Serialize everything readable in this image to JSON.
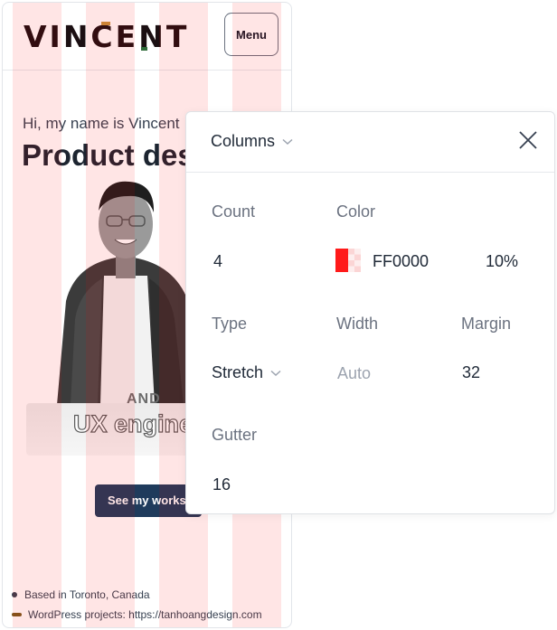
{
  "site": {
    "logo": "VINCENT",
    "menu_label": "Menu",
    "greeting": "Hi, my name is Vincent",
    "headline": "Product des",
    "and_text": "AND",
    "role_text": "UX engine",
    "cta_label": "See my works",
    "footer": {
      "location": "Based in Toronto, Canada",
      "wordpress": "WordPress projects: https://tanhoangdesign.com"
    }
  },
  "panel": {
    "title": "Columns",
    "count_label": "Count",
    "count_value": "4",
    "color_label": "Color",
    "color_hex": "FF0000",
    "color_opacity": "10%",
    "type_label": "Type",
    "type_value": "Stretch",
    "width_label": "Width",
    "width_placeholder": "Auto",
    "margin_label": "Margin",
    "margin_value": "32",
    "gutter_label": "Gutter",
    "gutter_value": "16"
  },
  "icons": {
    "title_chevron": "chevron-down-icon",
    "type_chevron": "chevron-down-icon",
    "close": "close-icon",
    "swatch": "color-swatch-icon"
  },
  "colors": {
    "grid_column": "#FF0000",
    "cta_background": "#1f3b5c",
    "accent_gold": "#c8913a",
    "accent_green": "#2f6b3a"
  }
}
